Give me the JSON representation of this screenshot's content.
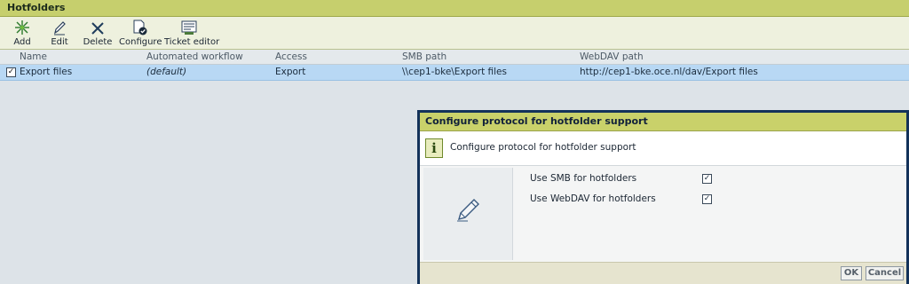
{
  "panel": {
    "title": "Hotfolders"
  },
  "toolbar": {
    "add": "Add",
    "edit": "Edit",
    "delete": "Delete",
    "configure": "Configure",
    "ticket_editor": "Ticket editor"
  },
  "grid": {
    "columns": [
      "Name",
      "Automated workflow",
      "Access",
      "SMB path",
      "WebDAV path"
    ],
    "rows": [
      {
        "checked": true,
        "name": "Export files",
        "workflow": "(default)",
        "access": "Export",
        "smb": "\\\\cep1-bke\\Export files",
        "webdav": "http://cep1-bke.oce.nl/dav/Export files"
      }
    ]
  },
  "dialog": {
    "title": "Configure protocol for hotfolder support",
    "info_icon": "i",
    "info_text": "Configure protocol for hotfolder support",
    "options": [
      {
        "label": "Use SMB for hotfolders",
        "checked": true
      },
      {
        "label": "Use WebDAV for hotfolders",
        "checked": true
      }
    ],
    "ok": "OK",
    "cancel": "Cancel"
  },
  "colors": {
    "title_bar": "#c6cf6d",
    "selected_row": "#b8d8f4",
    "dialog_border": "#13325a"
  },
  "icons": [
    "add-icon",
    "edit-icon",
    "delete-icon",
    "configure-icon",
    "ticket-editor-icon",
    "info-icon",
    "pencil-icon",
    "checkmark-icon"
  ]
}
